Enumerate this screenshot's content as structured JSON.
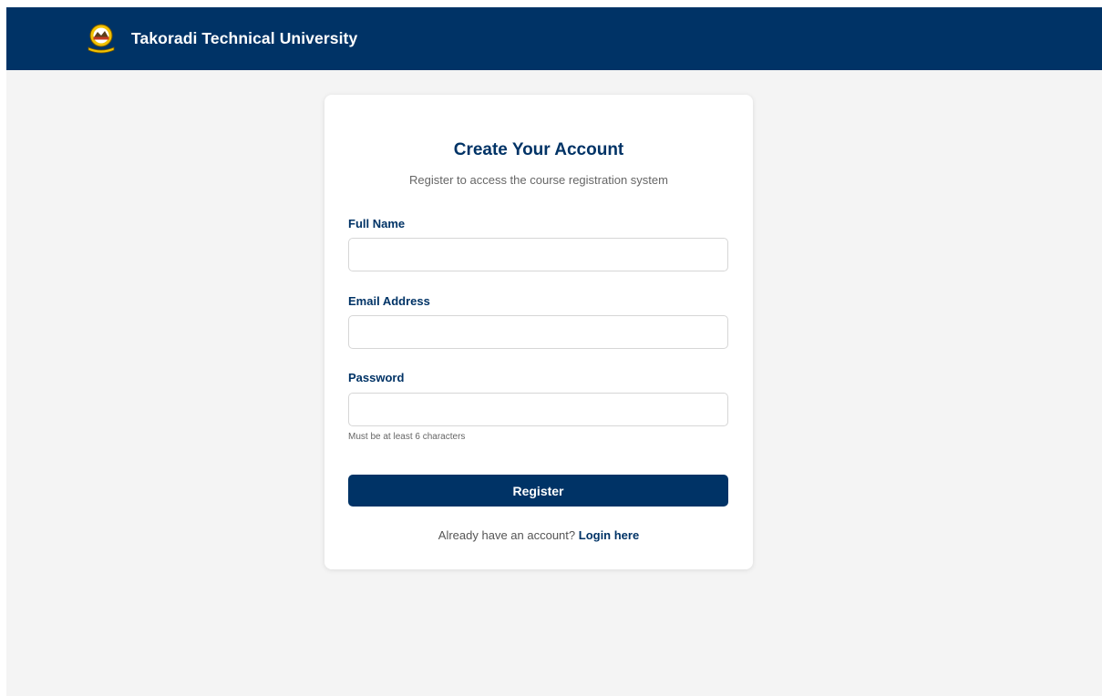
{
  "navbar": {
    "brand": "Takoradi Technical University",
    "logo_icon": "university-crest-icon",
    "background": "#003366"
  },
  "form": {
    "title": "Create Your Account",
    "subtitle": "Register to access the course registration system",
    "full_name": {
      "label": "Full Name",
      "value": ""
    },
    "email": {
      "label": "Email Address",
      "value": ""
    },
    "password": {
      "label": "Password",
      "value": "",
      "hint": "Must be at least 6 characters"
    },
    "submit_label": "Register",
    "login_prompt": "Already have an account?",
    "login_link": "Login here"
  },
  "colors": {
    "primary": "#003366",
    "page_background": "#f4f4f4",
    "muted_text": "#666666"
  }
}
